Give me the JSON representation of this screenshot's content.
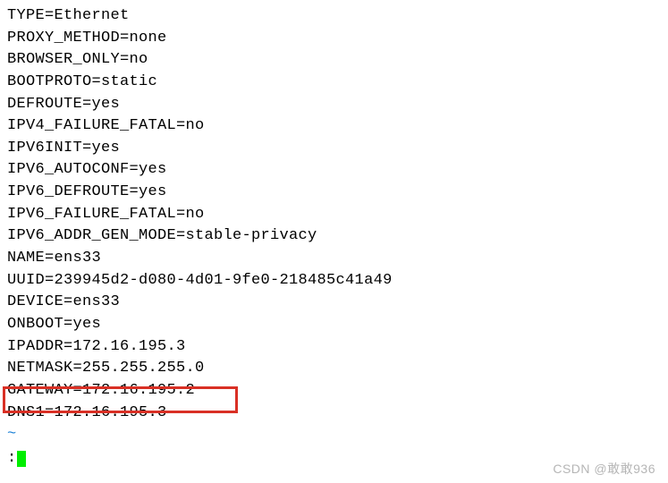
{
  "config_lines": [
    "TYPE=Ethernet",
    "PROXY_METHOD=none",
    "BROWSER_ONLY=no",
    "BOOTPROTO=static",
    "DEFROUTE=yes",
    "IPV4_FAILURE_FATAL=no",
    "IPV6INIT=yes",
    "IPV6_AUTOCONF=yes",
    "IPV6_DEFROUTE=yes",
    "IPV6_FAILURE_FATAL=no",
    "IPV6_ADDR_GEN_MODE=stable-privacy",
    "NAME=ens33",
    "UUID=239945d2-d080-4d01-9fe0-218485c41a49",
    "DEVICE=ens33",
    "ONBOOT=yes",
    "IPADDR=172.16.195.3",
    "NETMASK=255.255.255.0",
    "GATEWAY=172.16.195.2",
    "DNS1=172.16.195.3"
  ],
  "end_marker": "~",
  "prompt": ":",
  "watermark": "CSDN @敢敢936"
}
